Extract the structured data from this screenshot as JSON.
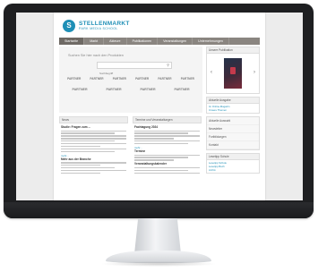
{
  "site": {
    "logo": {
      "mark": "S",
      "title": "STELLENMARKT",
      "subtitle": "PARK  MEDIA  SCHOOL"
    },
    "nav": [
      {
        "label": "Startseite",
        "active": true
      },
      {
        "label": "Markt"
      },
      {
        "label": "Akteure"
      },
      {
        "label": "Publikationen"
      },
      {
        "label": "Veranstaltungen"
      },
      {
        "label": "Unternehmungen"
      }
    ],
    "hero": {
      "tagline": "Suchen Sie hier nach den Produkten",
      "search_placeholder": "Suchbegriff",
      "logos_row1": [
        "PARTNER",
        "PARTNER",
        "PARTNER",
        "PARTNER",
        "PARTNER",
        "PARTNER"
      ],
      "logos_row2": [
        "PARTNER",
        "PARTNER",
        "PARTNER",
        "PARTNER"
      ]
    },
    "sidebar": {
      "featured_header": "Unsere Publikation",
      "links_header": "Aktuelle Ausgabe",
      "links": [
        "Im Online-Magazin",
        "Unsere Themen"
      ],
      "items": [
        "Aktuelle Auswahl",
        "Newsletter",
        "Fortbildungen",
        "Kontakt"
      ],
      "box_header": "Lesetipp Schule",
      "box_links": [
        "Lesetipp Schule",
        "Lesetipp Buch",
        "Archiv"
      ]
    },
    "columns": {
      "left": {
        "header": "News",
        "title1": "Studie: Fragen zum ...",
        "title2": "Mehr aus der Branche",
        "more": "mehr..."
      },
      "mid": {
        "header": "Termine und Veranstaltungen",
        "title1": "Fachtagung 2024",
        "title2": "Termine",
        "title3": "Veranstaltungskalender",
        "more": "mehr..."
      }
    }
  }
}
